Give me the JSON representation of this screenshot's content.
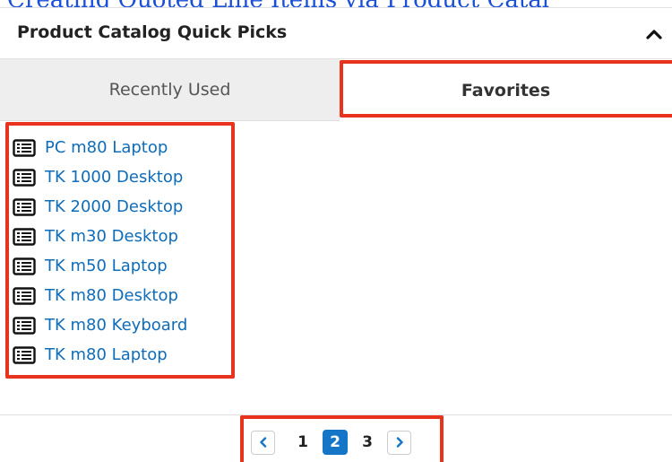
{
  "top_link": {
    "text": "Creating Quoted Line Items via Product Catal"
  },
  "dashlet": {
    "title": "Product Catalog Quick Picks",
    "collapse_icon": "chevron-up-icon"
  },
  "tabs": [
    {
      "label": "Recently Used",
      "active": false
    },
    {
      "label": "Favorites",
      "active": true
    }
  ],
  "products": [
    {
      "label": "PC m80 Laptop",
      "icon": "list-icon"
    },
    {
      "label": "TK 1000 Desktop",
      "icon": "list-icon"
    },
    {
      "label": "TK 2000 Desktop",
      "icon": "list-icon"
    },
    {
      "label": "TK m30 Desktop",
      "icon": "list-icon"
    },
    {
      "label": "TK m50 Laptop",
      "icon": "list-icon"
    },
    {
      "label": "TK m80 Desktop",
      "icon": "list-icon"
    },
    {
      "label": "TK m80 Keyboard",
      "icon": "list-icon"
    },
    {
      "label": "TK m80 Laptop",
      "icon": "list-icon"
    }
  ],
  "pagination": {
    "prev_icon": "chevron-left-icon",
    "next_icon": "chevron-right-icon",
    "pages": [
      "1",
      "2",
      "3"
    ],
    "current_page": "2"
  },
  "colors": {
    "link_blue": "#0f6cb8",
    "highlight_red": "#e8331e",
    "active_page": "#1576c8",
    "tab_bg": "#eeeeee"
  }
}
